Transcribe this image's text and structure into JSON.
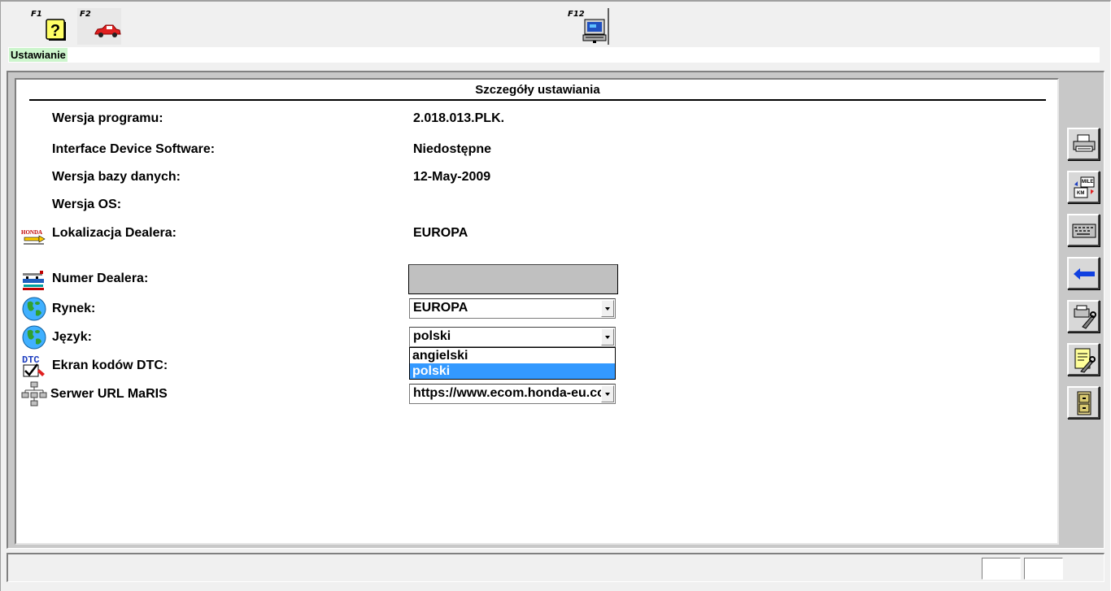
{
  "toolbar": {
    "f1_label": "F1",
    "f2_label": "F2",
    "f12_label": "F12"
  },
  "header": {
    "section_tag": "Ustawianie"
  },
  "panel": {
    "title": "Szczegóły ustawiania",
    "rows": {
      "program_version": {
        "label": "Wersja programu:",
        "value": "2.018.013.PLK."
      },
      "interface_software": {
        "label": "Interface Device Software:",
        "value": "Niedostępne"
      },
      "database_version": {
        "label": "Wersja bazy danych:",
        "value": "12-May-2009"
      },
      "os_version": {
        "label": "Wersja OS:",
        "value": ""
      },
      "dealer_location": {
        "label": "Lokalizacja Dealera:",
        "value": "EUROPA"
      },
      "dealer_number": {
        "label": "Numer Dealera:",
        "value": ""
      },
      "market": {
        "label": "Rynek:",
        "value": "EUROPA"
      },
      "language": {
        "label": "Język:",
        "value": "polski",
        "options": [
          "angielski",
          "polski"
        ],
        "selected": "polski"
      },
      "dtc_screen": {
        "label": "Ekran kodów DTC:"
      },
      "maris_url": {
        "label": "Serwer URL MaRIS",
        "value": "https://www.ecom.honda-eu.com"
      }
    },
    "icons": {
      "dealer_location_logo": "HONDA"
    }
  },
  "sidebar": {
    "buttons": [
      "print-icon",
      "mile-km-convert-icon",
      "keyboard-icon",
      "back-arrow-icon",
      "printer-settings-icon",
      "notepad-settings-icon",
      "cabinet-icon"
    ]
  },
  "colors": {
    "selection": "#3399ff",
    "tag_bg": "#ccf5cc"
  }
}
